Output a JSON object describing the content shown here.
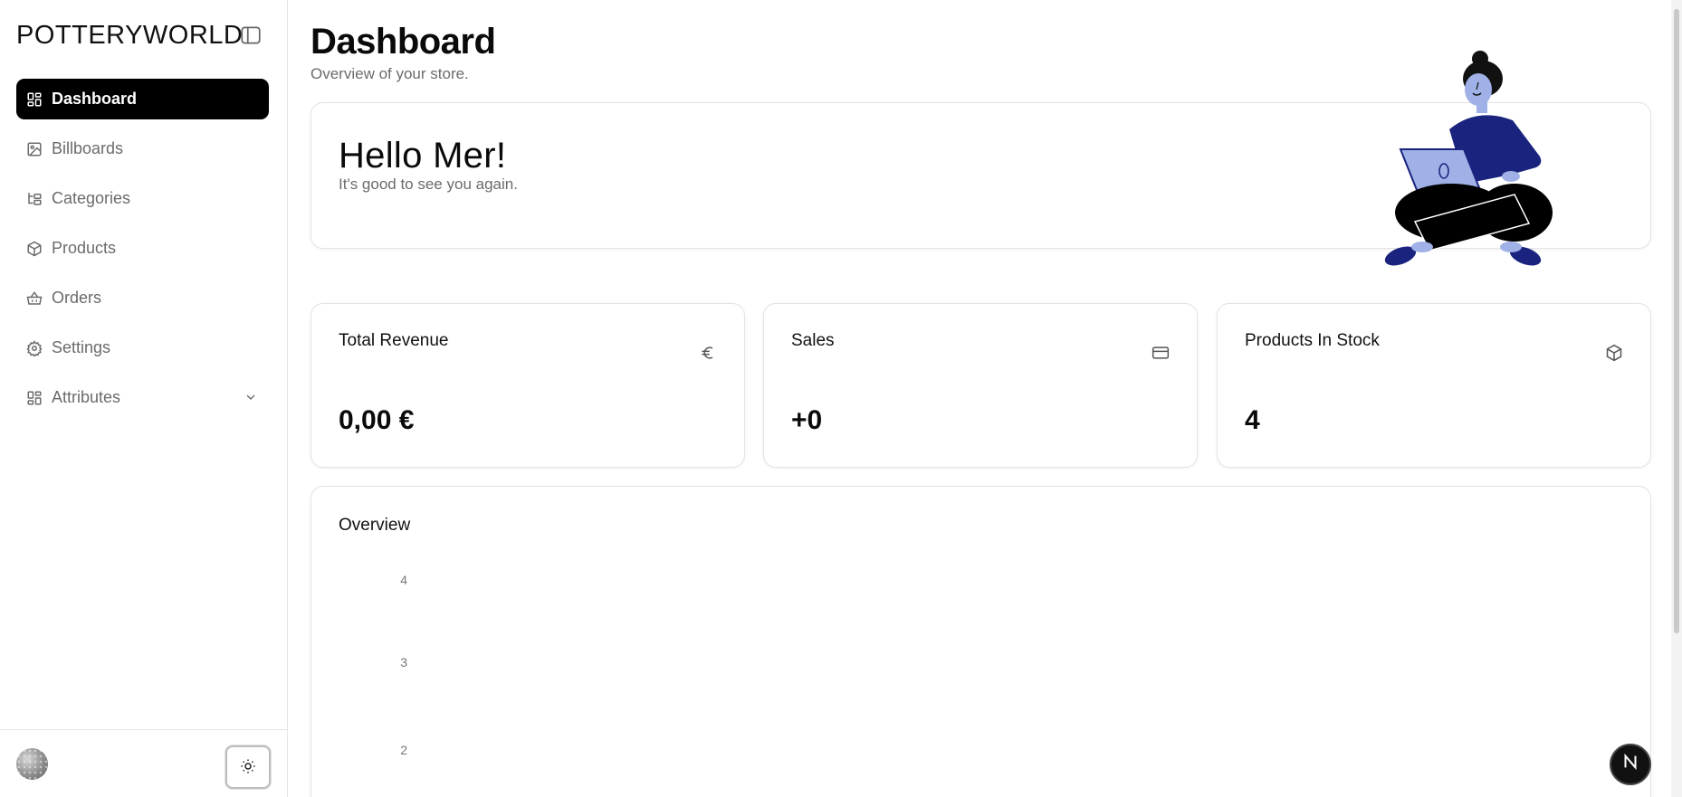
{
  "sidebar": {
    "brand": "POTTERYWORLD",
    "items": [
      {
        "label": "Dashboard",
        "icon": "dashboard-icon",
        "active": true
      },
      {
        "label": "Billboards",
        "icon": "image-icon"
      },
      {
        "label": "Categories",
        "icon": "folder-tree-icon"
      },
      {
        "label": "Products",
        "icon": "package-icon"
      },
      {
        "label": "Orders",
        "icon": "basket-icon"
      },
      {
        "label": "Settings",
        "icon": "gear-icon"
      },
      {
        "label": "Attributes",
        "icon": "dashboard-icon",
        "expandable": true
      }
    ]
  },
  "header": {
    "title": "Dashboard",
    "subtitle": "Overview of your store."
  },
  "hello": {
    "title": "Hello Mer!",
    "subtitle": "It's good to see you again."
  },
  "stats": [
    {
      "label": "Total Revenue",
      "value": "0,00 €",
      "icon": "euro-icon"
    },
    {
      "label": "Sales",
      "value": "+0",
      "icon": "credit-card-icon"
    },
    {
      "label": "Products In Stock",
      "value": "4",
      "icon": "package-icon"
    }
  ],
  "overview": {
    "title": "Overview"
  },
  "chart_data": {
    "type": "bar",
    "title": "Overview",
    "yticks": [
      "4",
      "3",
      "2"
    ],
    "categories": [],
    "values": []
  },
  "colors": {
    "accent": "#000000",
    "illustration_primary": "#1a237e",
    "illustration_light": "#9fb1e6"
  }
}
